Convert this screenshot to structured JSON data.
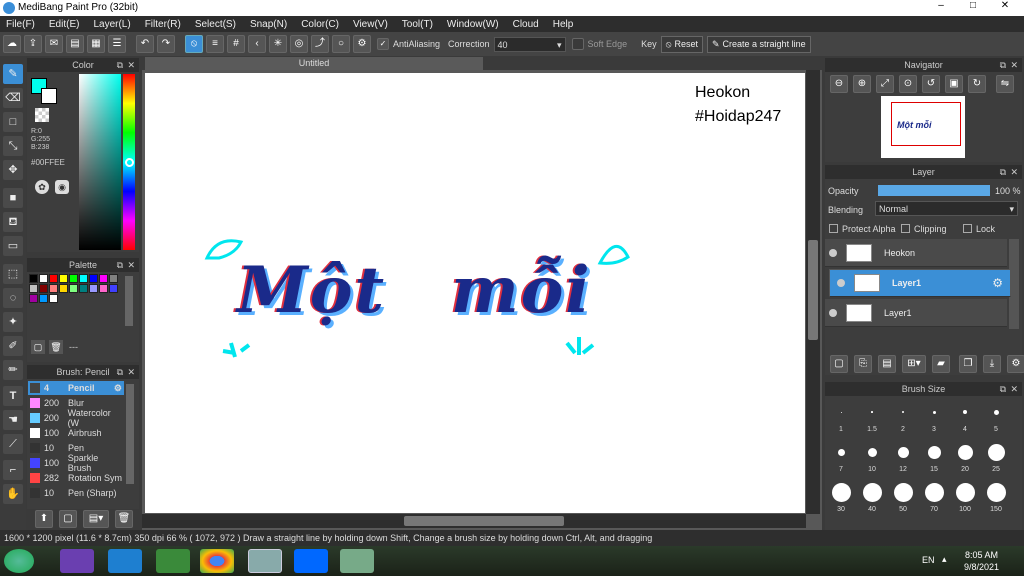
{
  "window": {
    "title": "MediBang Paint Pro (32bit)",
    "min": "–",
    "max": "□",
    "close": "✕"
  },
  "menu": [
    "File(F)",
    "Edit(E)",
    "Layer(L)",
    "Filter(R)",
    "Select(S)",
    "Snap(N)",
    "Color(C)",
    "View(V)",
    "Tool(T)",
    "Window(W)",
    "Cloud",
    "Help"
  ],
  "toolbar": {
    "antialiasing": "AntiAliasing",
    "correction_label": "Correction",
    "correction_value": "40",
    "soft_edge": "Soft Edge",
    "key": "Key",
    "reset": "Reset",
    "straight_line": "Create a straight line"
  },
  "color_panel": {
    "title": "Color",
    "r": "R:0",
    "g": "G:255",
    "b": "B:238",
    "hex": "#00FFEE",
    "fg": "#00FFEE"
  },
  "palette_panel": {
    "title": "Palette",
    "colors": [
      "#000000",
      "#ffffff",
      "#ff0000",
      "#ffff00",
      "#00ff00",
      "#00ffff",
      "#0000ff",
      "#ff00ff",
      "#808080",
      "#c0c0c0",
      "#800000",
      "#ff8080",
      "#ffd700",
      "#80ff80",
      "#008080",
      "#9999ff",
      "#ff66cc",
      "#4040ff",
      "#a000a0",
      "#0099ff",
      "#ffffff"
    ],
    "empty": "---"
  },
  "brush_panel": {
    "title": "Brush: Pencil",
    "items": [
      {
        "size": "4",
        "name": "Pencil",
        "color": "#444444"
      },
      {
        "size": "200",
        "name": "Blur",
        "color": "#ff88ff"
      },
      {
        "size": "200",
        "name": "Watercolor (W",
        "color": "#66ccff"
      },
      {
        "size": "100",
        "name": "Airbrush",
        "color": "#ffffff"
      },
      {
        "size": "10",
        "name": "Pen",
        "color": "#333333"
      },
      {
        "size": "100",
        "name": "Sparkle Brush",
        "color": "#4444ff"
      },
      {
        "size": "282",
        "name": "Rotation Sym",
        "color": "#ff4444"
      },
      {
        "size": "10",
        "name": "Pen (Sharp)",
        "color": "#333333"
      }
    ]
  },
  "canvas": {
    "tab": "Untitled",
    "watermark_line1": "Heokon",
    "watermark_line2": "#Hoidap247",
    "word1": "Một",
    "word2": "mỗi"
  },
  "navigator": {
    "title": "Navigator"
  },
  "layer_panel": {
    "title": "Layer",
    "opacity_label": "Opacity",
    "opacity_value": "100 %",
    "opacity_fraction": 1.0,
    "blending_label": "Blending",
    "blending_value": "Normal",
    "protect_alpha": "Protect Alpha",
    "clipping": "Clipping",
    "lock": "Lock",
    "layers": [
      {
        "name": "Heokon",
        "selected": false
      },
      {
        "name": "Layer1",
        "selected": true
      },
      {
        "name": "Layer1",
        "selected": false
      }
    ]
  },
  "brush_size": {
    "title": "Brush Size",
    "sizes": [
      "1",
      "1.5",
      "2",
      "3",
      "4",
      "5",
      "7",
      "10",
      "12",
      "15",
      "20",
      "25",
      "30",
      "40",
      "50",
      "70",
      "100",
      "150"
    ]
  },
  "status": "1600 * 1200 pixel   (11.6 * 8.7cm)   350 dpi   66 %   ( 1072, 972 )   Draw a straight line by holding down Shift, Change a brush size by holding down Ctrl, Alt, and dragging",
  "taskbar": {
    "lang": "EN",
    "time": "8:05 AM",
    "date": "9/8/2021"
  }
}
